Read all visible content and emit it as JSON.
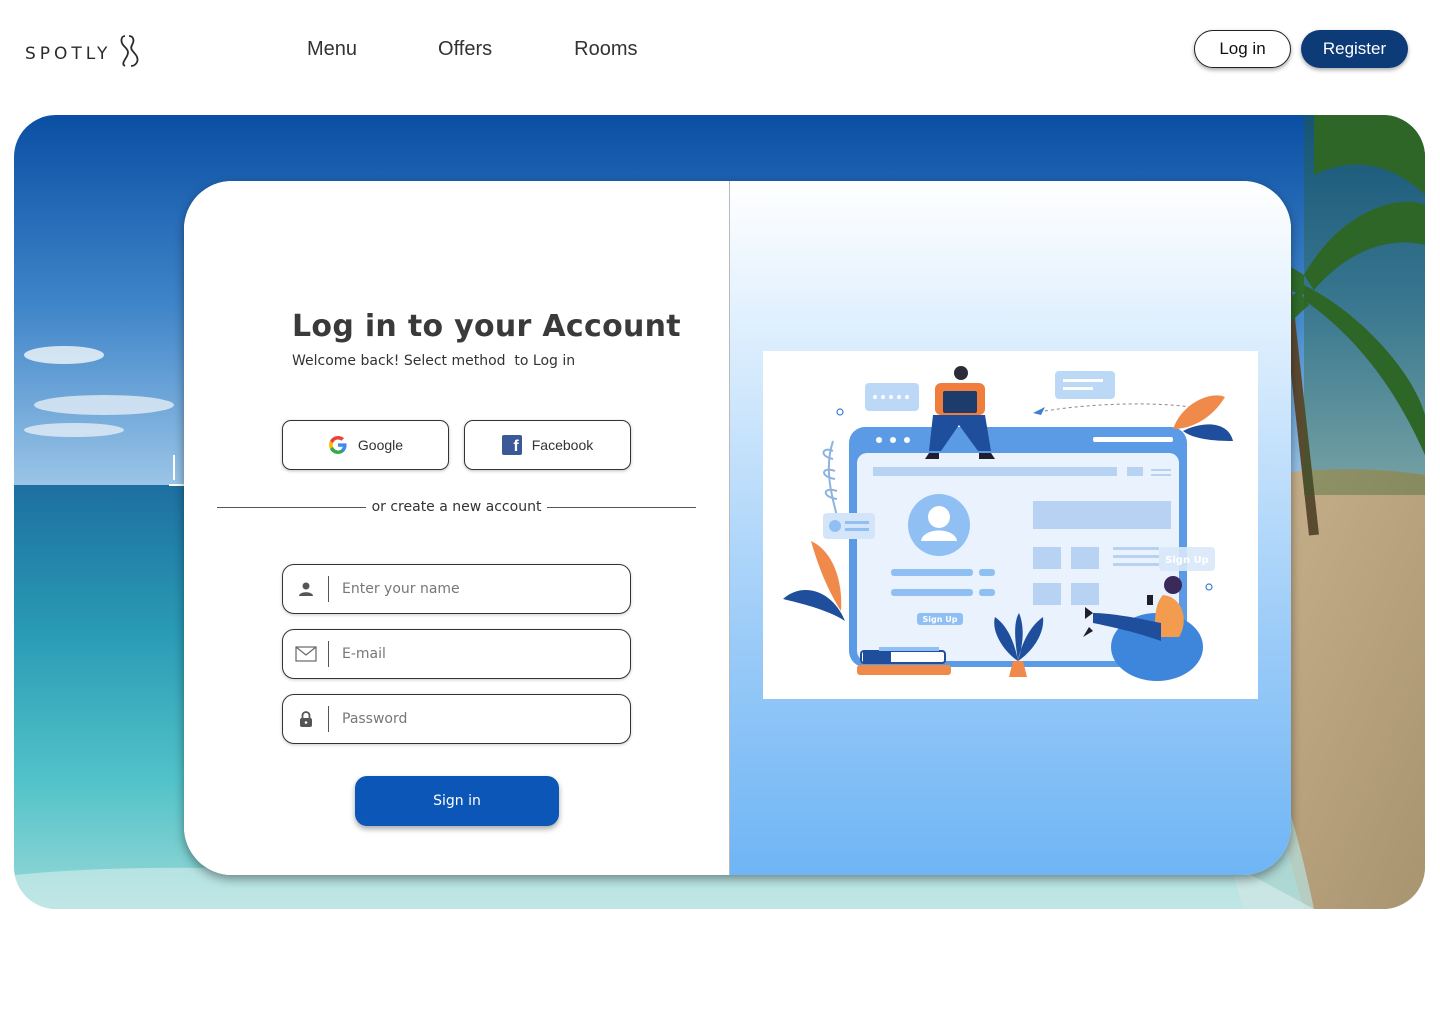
{
  "header": {
    "logo_text": "SPOTLY",
    "nav": [
      {
        "label": "Menu"
      },
      {
        "label": "Offers"
      },
      {
        "label": "Rooms"
      }
    ],
    "login_label": "Log in",
    "register_label": "Register"
  },
  "login": {
    "title": "Log in to your Account",
    "subtitle": "Welcome back! Select method  to Log in",
    "google_label": "Google",
    "facebook_label": "Facebook",
    "divider_text": "or create a new account",
    "name_placeholder": "Enter your name",
    "email_placeholder": "E-mail",
    "password_placeholder": "Password",
    "signin_label": "Sign in"
  },
  "illustration": {
    "form_label": "Sign Up",
    "panel_label": "Sign Up"
  },
  "colors": {
    "brand_dark": "#0d3b78",
    "button_primary": "#0b56b6",
    "illustration_accent": "#4a90e2"
  }
}
